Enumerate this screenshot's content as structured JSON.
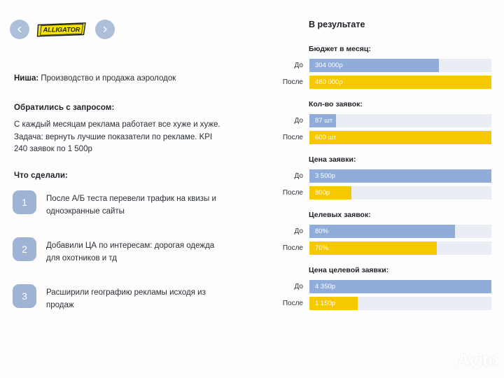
{
  "brand": {
    "prev_icon": "chevron-left-icon",
    "next_icon": "chevron-right-icon",
    "logo_text": "ALLIGATOR",
    "logo_bg": "#f5e400",
    "logo_border": "#1d2026"
  },
  "left": {
    "niche_label": "Ниша:",
    "niche_value": " Производство и продажа аэролодок",
    "request_title": "Обратились с запросом:",
    "request_body": "С каждый месяцам реклама работает все хуже и хуже. Задача: вернуть лучшие показатели по рекламе. KPI 240 заявок по 1 500р",
    "did_title": "Что сделали:",
    "steps": [
      {
        "number": "1",
        "text": "После А/Б теста перевели трафик на квизы и одноэкранные сайты"
      },
      {
        "number": "2",
        "text": "Добавили ЦА по интересам: дорогая одежда для охотников и тд"
      },
      {
        "number": "3",
        "text": "Расширили географию рекламы исходя из продаж"
      }
    ]
  },
  "right": {
    "results_title": "В результате",
    "label_before": "До",
    "label_after": "После"
  },
  "colors": {
    "before_bar": "#8fadd8",
    "after_bar": "#f5c800",
    "track": "#eaeef4",
    "badge": "#9fb4d4",
    "nav_circle": "#aebfd9",
    "text": "#2b2f36"
  },
  "watermark": {
    "text": "Avito",
    "icon": "avito-dots-icon"
  },
  "chart_data": [
    {
      "type": "bar",
      "title": "Бюджет в месяц:",
      "categories": [
        "До",
        "После"
      ],
      "values": [
        304000,
        480000
      ],
      "value_labels": [
        "304 000р",
        "480 000р"
      ],
      "bar_percents": [
        71,
        100
      ],
      "xlabel": "",
      "ylabel": "",
      "grid": false,
      "legend": "none"
    },
    {
      "type": "bar",
      "title": "Кол-во заявок:",
      "categories": [
        "До",
        "После"
      ],
      "values": [
        87,
        600
      ],
      "value_labels": [
        "87 шт",
        "600 шт"
      ],
      "bar_percents": [
        14.5,
        100
      ],
      "xlabel": "",
      "ylabel": "",
      "grid": false,
      "legend": "none"
    },
    {
      "type": "bar",
      "title": "Цена заявки:",
      "categories": [
        "До",
        "После"
      ],
      "values": [
        3500,
        800
      ],
      "value_labels": [
        "3 500р",
        "800р"
      ],
      "bar_percents": [
        100,
        23
      ],
      "xlabel": "",
      "ylabel": "",
      "grid": false,
      "legend": "none"
    },
    {
      "type": "bar",
      "title": "Целевых заявок:",
      "categories": [
        "До",
        "После"
      ],
      "values": [
        80,
        70
      ],
      "value_labels": [
        "80%",
        "70%"
      ],
      "bar_percents": [
        80,
        70
      ],
      "xlabel": "",
      "ylabel": "",
      "grid": false,
      "legend": "none"
    },
    {
      "type": "bar",
      "title": "Цена целевой заявки:",
      "categories": [
        "До",
        "После"
      ],
      "values": [
        4350,
        1150
      ],
      "value_labels": [
        "4 350р",
        "1 150р"
      ],
      "bar_percents": [
        100,
        26.5
      ],
      "xlabel": "",
      "ylabel": "",
      "grid": false,
      "legend": "none"
    }
  ]
}
